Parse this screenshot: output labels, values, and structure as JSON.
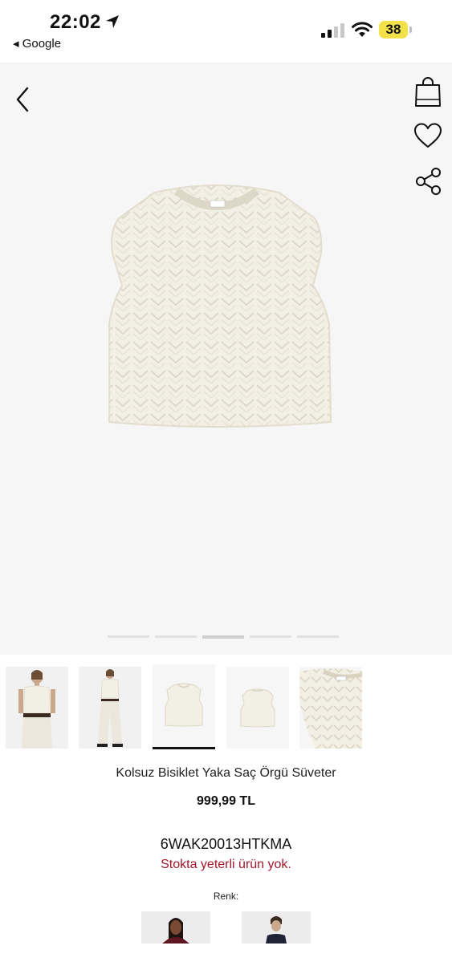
{
  "status_bar": {
    "time": "22:02",
    "back_app": "◂ Google",
    "battery": "38"
  },
  "icons": {
    "back": "chevron-left-icon",
    "cart": "shopping-bag-icon",
    "favorite": "heart-icon",
    "share": "share-icon",
    "location": "location-arrow-icon",
    "signal": "cellular-signal-icon",
    "wifi": "wifi-icon",
    "battery": "battery-icon"
  },
  "colors": {
    "gallery_bg": "#f6f6f7",
    "stock_red": "#a4182b",
    "battery_yellow": "#f3e14a",
    "garment": "#f2efe4"
  },
  "gallery": {
    "image_count": 5,
    "active_index": 2
  },
  "thumbnails": [
    {
      "kind": "model-front",
      "selected": false
    },
    {
      "kind": "model-full",
      "selected": false
    },
    {
      "kind": "product-flat",
      "selected": true
    },
    {
      "kind": "product-back",
      "selected": false
    },
    {
      "kind": "product-detail",
      "selected": false
    }
  ],
  "product": {
    "title": "Kolsuz Bisiklet Yaka Saç Örgü Süveter",
    "price": "999,99 TL",
    "sku": "6WAK20013HTKMA",
    "stock_message": "Stokta yeterli ürün yok.",
    "color_label": "Renk:"
  },
  "color_options": [
    {
      "kind": "model-burgundy"
    },
    {
      "kind": "model-navy"
    }
  ]
}
